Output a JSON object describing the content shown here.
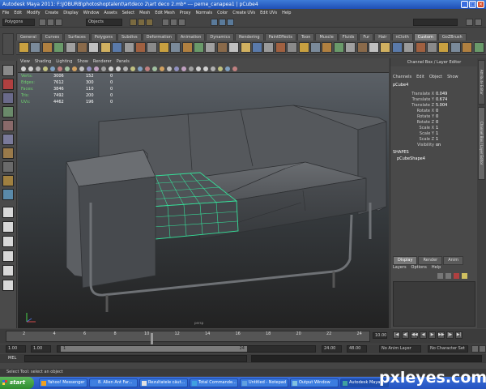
{
  "window": {
    "title": "Autodesk Maya 2011: F:\\JOBURB\\photoshoptalent\\artdeco 2\\art deco 2.mb*   ---   perne_canapea1 | pCube4"
  },
  "menubar": [
    "File",
    "Edit",
    "Modify",
    "Create",
    "Display",
    "Window",
    "Assets",
    "Select",
    "Mesh",
    "Edit Mesh",
    "Proxy",
    "Normals",
    "Color",
    "Create UVs",
    "Edit UVs",
    "Help"
  ],
  "statusline": {
    "mode": "Polygons",
    "selection_field": "Objects"
  },
  "shelf_tabs": [
    "General",
    "Curves",
    "Surfaces",
    "Polygons",
    "Subdivs",
    "Deformation",
    "Animation",
    "Dynamics",
    "Rendering",
    "PaintEffects",
    "Toon",
    "Muscle",
    "Fluids",
    "Fur",
    "Hair",
    "nCloth",
    "Custom",
    "GoZBrush"
  ],
  "shelf_active_tab": "Custom",
  "viewport": {
    "menu": [
      "View",
      "Shading",
      "Lighting",
      "Show",
      "Renderer",
      "Panels"
    ],
    "hud": [
      {
        "label": "Verts:",
        "a": "3006",
        "b": "152",
        "c": "0"
      },
      {
        "label": "Edges:",
        "a": "7612",
        "b": "300",
        "c": "0"
      },
      {
        "label": "Faces:",
        "a": "3846",
        "b": "110",
        "c": "0"
      },
      {
        "label": "Tris:",
        "a": "7492",
        "b": "200",
        "c": "0"
      },
      {
        "label": "UVs:",
        "a": "4462",
        "b": "196",
        "c": "0"
      }
    ],
    "camera_label": "persp"
  },
  "channel_box": {
    "title": "Channel Box / Layer Editor",
    "menu": [
      "Channels",
      "Edit",
      "Object",
      "Show"
    ],
    "object": "pCube4",
    "attributes": [
      {
        "name": "Translate X",
        "value": "0.049"
      },
      {
        "name": "Translate Y",
        "value": "0.674"
      },
      {
        "name": "Translate Z",
        "value": "5.004"
      },
      {
        "name": "Rotate X",
        "value": "0"
      },
      {
        "name": "Rotate Y",
        "value": "0"
      },
      {
        "name": "Rotate Z",
        "value": "0"
      },
      {
        "name": "Scale X",
        "value": "1"
      },
      {
        "name": "Scale Y",
        "value": "1"
      },
      {
        "name": "Scale Z",
        "value": "1"
      },
      {
        "name": "Visibility",
        "value": "on"
      }
    ],
    "shapes_header": "SHAPES",
    "shape_name": "pCubeShape4"
  },
  "layer_editor": {
    "tabs": [
      "Display",
      "Render",
      "Anim"
    ],
    "menu": [
      "Layers",
      "Options",
      "Help"
    ]
  },
  "side_tabs": [
    "Attribute Editor",
    "Channel Box / Layer Editor"
  ],
  "timeline": {
    "ticks": [
      "2",
      "4",
      "6",
      "8",
      "10",
      "12",
      "14",
      "16",
      "18",
      "20",
      "22",
      "24"
    ],
    "current_frame": "10.00",
    "range_start": "1.00",
    "range_start2": "1.00",
    "range_inner_start": "1",
    "range_inner_end": "24",
    "range_end": "24.00",
    "range_end2": "48.00",
    "anim_layer": "No Anim Layer",
    "char_set": "No Character Set",
    "play_buttons": [
      "|◀",
      "◀|",
      "◀◀",
      "◀",
      "▶",
      "▶▶",
      "|▶",
      "▶|"
    ]
  },
  "mel": {
    "label": "MEL"
  },
  "helpline": "Select Tool: select an object",
  "taskbar": {
    "start": "start",
    "tasks": [
      "Yahoo! Messenger",
      "8. Alien Ant Far...",
      "Rezultatele căut...",
      "Total Commande...",
      "Untitled - Notepad",
      "Output Window",
      "Autodesk Maya ..."
    ]
  },
  "watermark": "pxleyes.com",
  "colors": {
    "hud_green": "#6fd36f",
    "wire_green": "#36e09a",
    "sofa_grey": "#5e6165",
    "taskbar_blue": "#2553c0"
  }
}
